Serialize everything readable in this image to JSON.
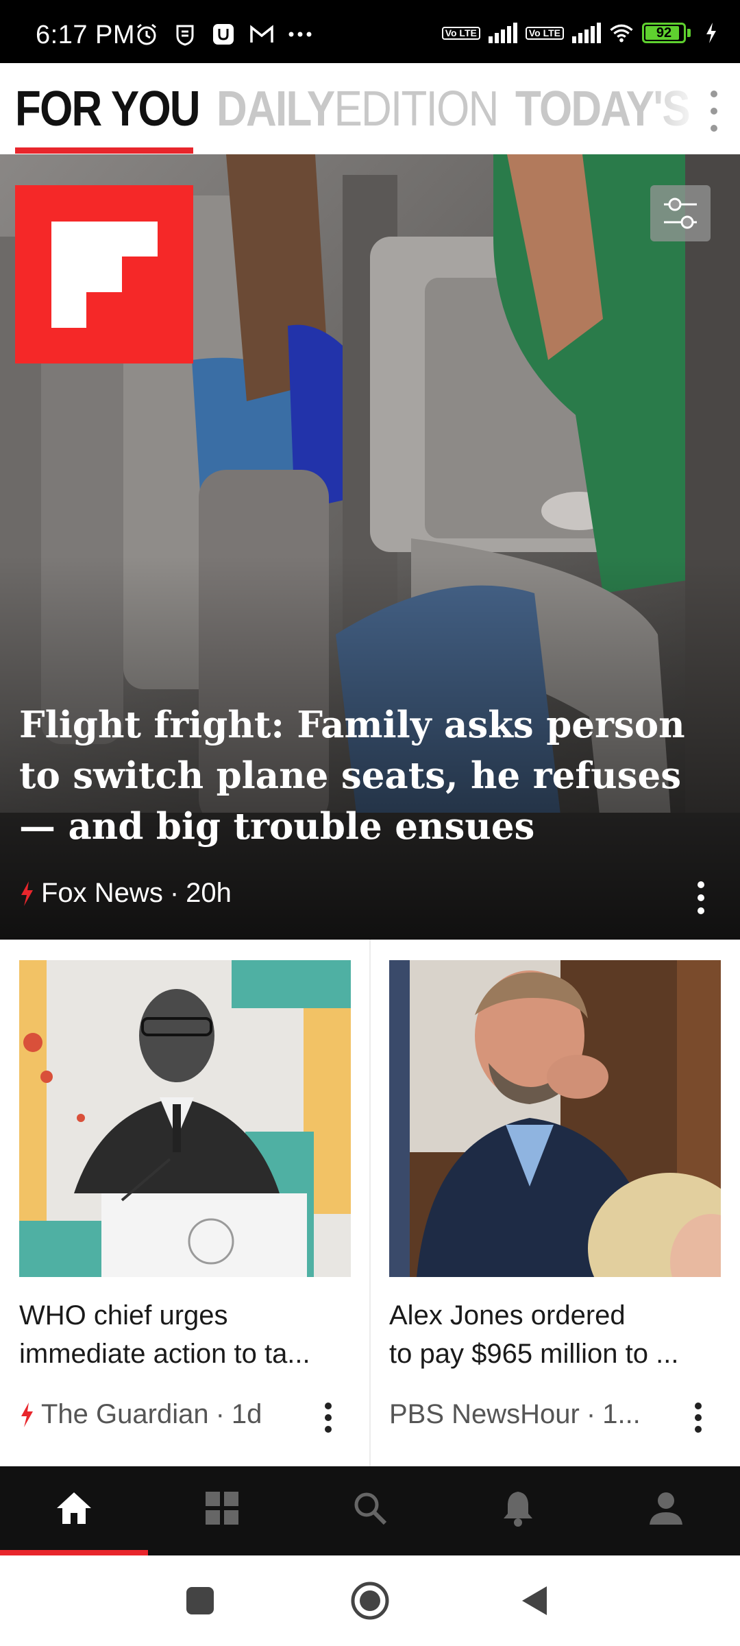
{
  "status_bar": {
    "time": "6:17 PM",
    "left_icons": [
      "alarm-icon",
      "shield-icon",
      "notification-app-icon",
      "gmail-icon",
      "more-icon"
    ],
    "network_badges": [
      "Vo LTE",
      "Vo LTE"
    ],
    "battery_level": "92"
  },
  "tabs": {
    "for_you": "FOR YOU",
    "daily_bold": "DAILY",
    "daily_thin": "EDITION",
    "today": "TODAY'S",
    "active_index": 0,
    "underline_color": "#e8262c"
  },
  "hero": {
    "headline": "Flight fright: Family asks person to switch plane seats, he refuses — and big trouble ensues",
    "source": "Fox News",
    "age": "20h",
    "logo_color": "#f52828"
  },
  "cards": [
    {
      "title_line1": "WHO chief urges",
      "title_line2": "immediate action to ta...",
      "source": "The Guardian",
      "age": "1d",
      "trending": true
    },
    {
      "title_line1": "Alex Jones ordered",
      "title_line2": "to pay $965 million to ...",
      "source": "PBS NewsHour",
      "age": "1...",
      "trending": false
    }
  ],
  "bottom_nav": {
    "items": [
      "home-icon",
      "grid-icon",
      "search-icon",
      "bell-icon",
      "profile-icon"
    ],
    "active_index": 0
  },
  "system_nav": [
    "recents-button",
    "home-button",
    "back-button"
  ],
  "colors": {
    "accent": "#e8262c",
    "nav_bg": "#111111"
  }
}
